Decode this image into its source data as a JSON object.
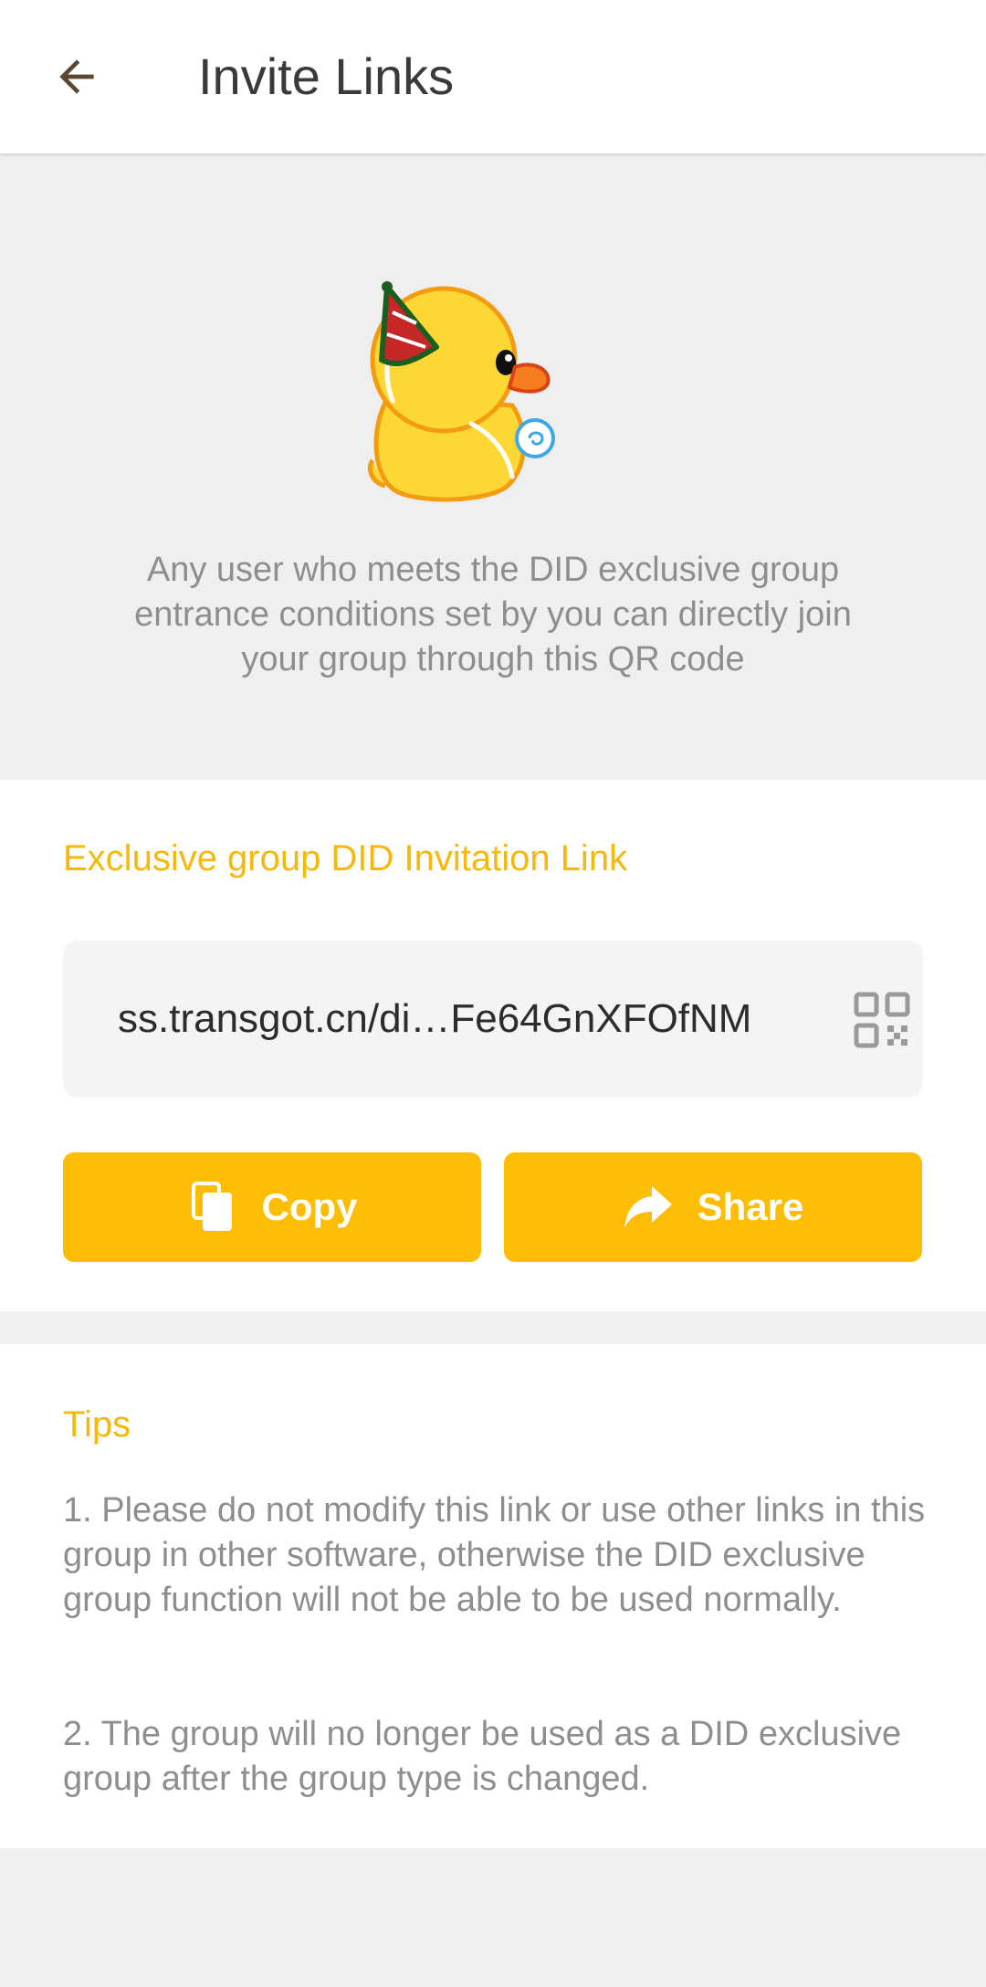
{
  "header": {
    "title": "Invite Links"
  },
  "hero": {
    "description": "Any user who meets the DID exclusive group entrance conditions set by you can directly join your group through this QR code"
  },
  "invite": {
    "section_title": "Exclusive group DID Invitation Link",
    "link_text": "ss.transgot.cn/di…Fe64GnXFOfNM",
    "copy_label": "Copy",
    "share_label": "Share"
  },
  "tips": {
    "title": "Tips",
    "items": [
      "1. Please do not modify this link or use other links in this group in other software, otherwise the DID exclusive group function will not be able to be used normally.",
      "2. The group will no longer be used as a DID exclusive group after the group type is changed."
    ]
  },
  "icons": {
    "back": "arrow-left-icon",
    "qr": "qr-code-icon",
    "copy": "copy-icon",
    "share": "share-icon",
    "illustration": "party-duck-illustration"
  },
  "colors": {
    "accent": "#fdbd04",
    "section_title": "#f6b80e",
    "background": "#efefef"
  }
}
